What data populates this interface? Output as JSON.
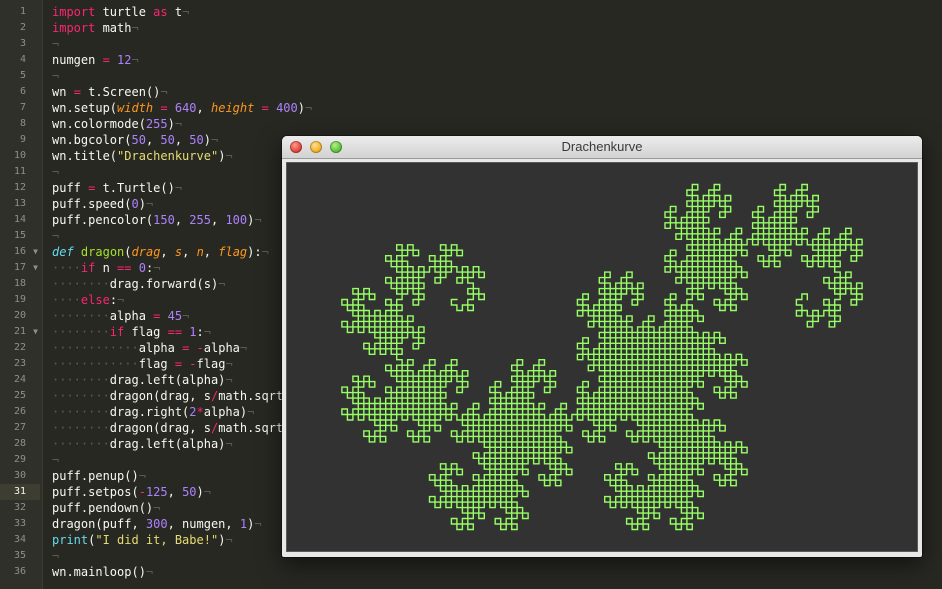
{
  "gutter": {
    "lines": [
      "1",
      "2",
      "3",
      "4",
      "5",
      "6",
      "7",
      "8",
      "9",
      "10",
      "11",
      "12",
      "13",
      "14",
      "15",
      "16",
      "17",
      "18",
      "19",
      "20",
      "21",
      "22",
      "23",
      "24",
      "25",
      "26",
      "27",
      "28",
      "29",
      "30",
      "31",
      "32",
      "33",
      "34",
      "35",
      "36"
    ],
    "current_line": "31"
  },
  "code": [
    [
      {
        "t": "import",
        "c": "kw"
      },
      {
        "t": " turtle "
      },
      {
        "t": "as",
        "c": "kw"
      },
      {
        "t": " t"
      }
    ],
    [
      {
        "t": "import",
        "c": "kw"
      },
      {
        "t": " math"
      }
    ],
    [],
    [
      {
        "t": "numgen "
      },
      {
        "t": "=",
        "c": "op"
      },
      {
        "t": " "
      },
      {
        "t": "12",
        "c": "nm"
      }
    ],
    [],
    [
      {
        "t": "wn "
      },
      {
        "t": "=",
        "c": "op"
      },
      {
        "t": " t.Screen()"
      }
    ],
    [
      {
        "t": "wn.setup("
      },
      {
        "t": "width",
        "c": "pa"
      },
      {
        "t": " "
      },
      {
        "t": "=",
        "c": "op"
      },
      {
        "t": " "
      },
      {
        "t": "640",
        "c": "nm"
      },
      {
        "t": ", "
      },
      {
        "t": "height",
        "c": "pa"
      },
      {
        "t": " "
      },
      {
        "t": "=",
        "c": "op"
      },
      {
        "t": " "
      },
      {
        "t": "400",
        "c": "nm"
      },
      {
        "t": ")"
      }
    ],
    [
      {
        "t": "wn.colormode("
      },
      {
        "t": "255",
        "c": "nm"
      },
      {
        "t": ")"
      }
    ],
    [
      {
        "t": "wn.bgcolor("
      },
      {
        "t": "50",
        "c": "nm"
      },
      {
        "t": ", "
      },
      {
        "t": "50",
        "c": "nm"
      },
      {
        "t": ", "
      },
      {
        "t": "50",
        "c": "nm"
      },
      {
        "t": ")"
      }
    ],
    [
      {
        "t": "wn.title("
      },
      {
        "t": "\"Drachenkurve\"",
        "c": "st"
      },
      {
        "t": ")"
      }
    ],
    [],
    [
      {
        "t": "puff "
      },
      {
        "t": "=",
        "c": "op"
      },
      {
        "t": " t.Turtle()"
      }
    ],
    [
      {
        "t": "puff.speed("
      },
      {
        "t": "0",
        "c": "nm"
      },
      {
        "t": ")"
      }
    ],
    [
      {
        "t": "puff.pencolor("
      },
      {
        "t": "150",
        "c": "nm"
      },
      {
        "t": ", "
      },
      {
        "t": "255",
        "c": "nm"
      },
      {
        "t": ", "
      },
      {
        "t": "100",
        "c": "nm"
      },
      {
        "t": ")"
      }
    ],
    [],
    [
      {
        "t": "def",
        "c": "df"
      },
      {
        "t": " "
      },
      {
        "t": "dragon",
        "c": "fn"
      },
      {
        "t": "("
      },
      {
        "t": "drag",
        "c": "pa"
      },
      {
        "t": ", "
      },
      {
        "t": "s",
        "c": "pa"
      },
      {
        "t": ", "
      },
      {
        "t": "n",
        "c": "pa"
      },
      {
        "t": ", "
      },
      {
        "t": "flag",
        "c": "pa"
      },
      {
        "t": "):"
      }
    ],
    [
      {
        "t": "····",
        "c": "inv"
      },
      {
        "t": "if",
        "c": "kw"
      },
      {
        "t": " n "
      },
      {
        "t": "==",
        "c": "op"
      },
      {
        "t": " "
      },
      {
        "t": "0",
        "c": "nm"
      },
      {
        "t": ":"
      }
    ],
    [
      {
        "t": "········",
        "c": "inv"
      },
      {
        "t": "drag.forward(s)"
      }
    ],
    [
      {
        "t": "····",
        "c": "inv"
      },
      {
        "t": "else",
        "c": "kw"
      },
      {
        "t": ":"
      }
    ],
    [
      {
        "t": "········",
        "c": "inv"
      },
      {
        "t": "alpha "
      },
      {
        "t": "=",
        "c": "op"
      },
      {
        "t": " "
      },
      {
        "t": "45",
        "c": "nm"
      }
    ],
    [
      {
        "t": "········",
        "c": "inv"
      },
      {
        "t": "if",
        "c": "kw"
      },
      {
        "t": " flag "
      },
      {
        "t": "==",
        "c": "op"
      },
      {
        "t": " "
      },
      {
        "t": "1",
        "c": "nm"
      },
      {
        "t": ":"
      }
    ],
    [
      {
        "t": "············",
        "c": "inv"
      },
      {
        "t": "alpha "
      },
      {
        "t": "=",
        "c": "op"
      },
      {
        "t": " "
      },
      {
        "t": "-",
        "c": "op"
      },
      {
        "t": "alpha"
      }
    ],
    [
      {
        "t": "············",
        "c": "inv"
      },
      {
        "t": "flag "
      },
      {
        "t": "=",
        "c": "op"
      },
      {
        "t": " "
      },
      {
        "t": "-",
        "c": "op"
      },
      {
        "t": "flag"
      }
    ],
    [
      {
        "t": "········",
        "c": "inv"
      },
      {
        "t": "drag.left(alpha)"
      }
    ],
    [
      {
        "t": "········",
        "c": "inv"
      },
      {
        "t": "dragon(drag, s"
      },
      {
        "t": "/",
        "c": "op"
      },
      {
        "t": "math.sqrt"
      }
    ],
    [
      {
        "t": "········",
        "c": "inv"
      },
      {
        "t": "drag.right("
      },
      {
        "t": "2",
        "c": "nm"
      },
      {
        "t": "*",
        "c": "op"
      },
      {
        "t": "alpha)"
      }
    ],
    [
      {
        "t": "········",
        "c": "inv"
      },
      {
        "t": "dragon(drag, s"
      },
      {
        "t": "/",
        "c": "op"
      },
      {
        "t": "math.sqrt"
      }
    ],
    [
      {
        "t": "········",
        "c": "inv"
      },
      {
        "t": "drag.left(alpha)"
      }
    ],
    [],
    [
      {
        "t": "puff.penup()"
      }
    ],
    [
      {
        "t": "puff.setpos("
      },
      {
        "t": "-",
        "c": "op"
      },
      {
        "t": "125",
        "c": "nm"
      },
      {
        "t": ", "
      },
      {
        "t": "50",
        "c": "nm"
      },
      {
        "t": ")"
      }
    ],
    [
      {
        "t": "puff.pendown()"
      }
    ],
    [
      {
        "t": "dragon(puff, "
      },
      {
        "t": "300",
        "c": "nm"
      },
      {
        "t": ", numgen, "
      },
      {
        "t": "1",
        "c": "nm"
      },
      {
        "t": ")"
      }
    ],
    [
      {
        "t": "print",
        "c": "bi"
      },
      {
        "t": "("
      },
      {
        "t": "\"I did it, Babe!\"",
        "c": "st"
      },
      {
        "t": ")"
      }
    ],
    [],
    [
      {
        "t": "wn.mainloop()"
      }
    ]
  ],
  "fold_markers": [
    "16",
    "17",
    "21"
  ],
  "window": {
    "title": "Drachenkurve",
    "canvas": {
      "background": "#323232",
      "pen_color": "#96ff64",
      "generations": 12
    }
  }
}
